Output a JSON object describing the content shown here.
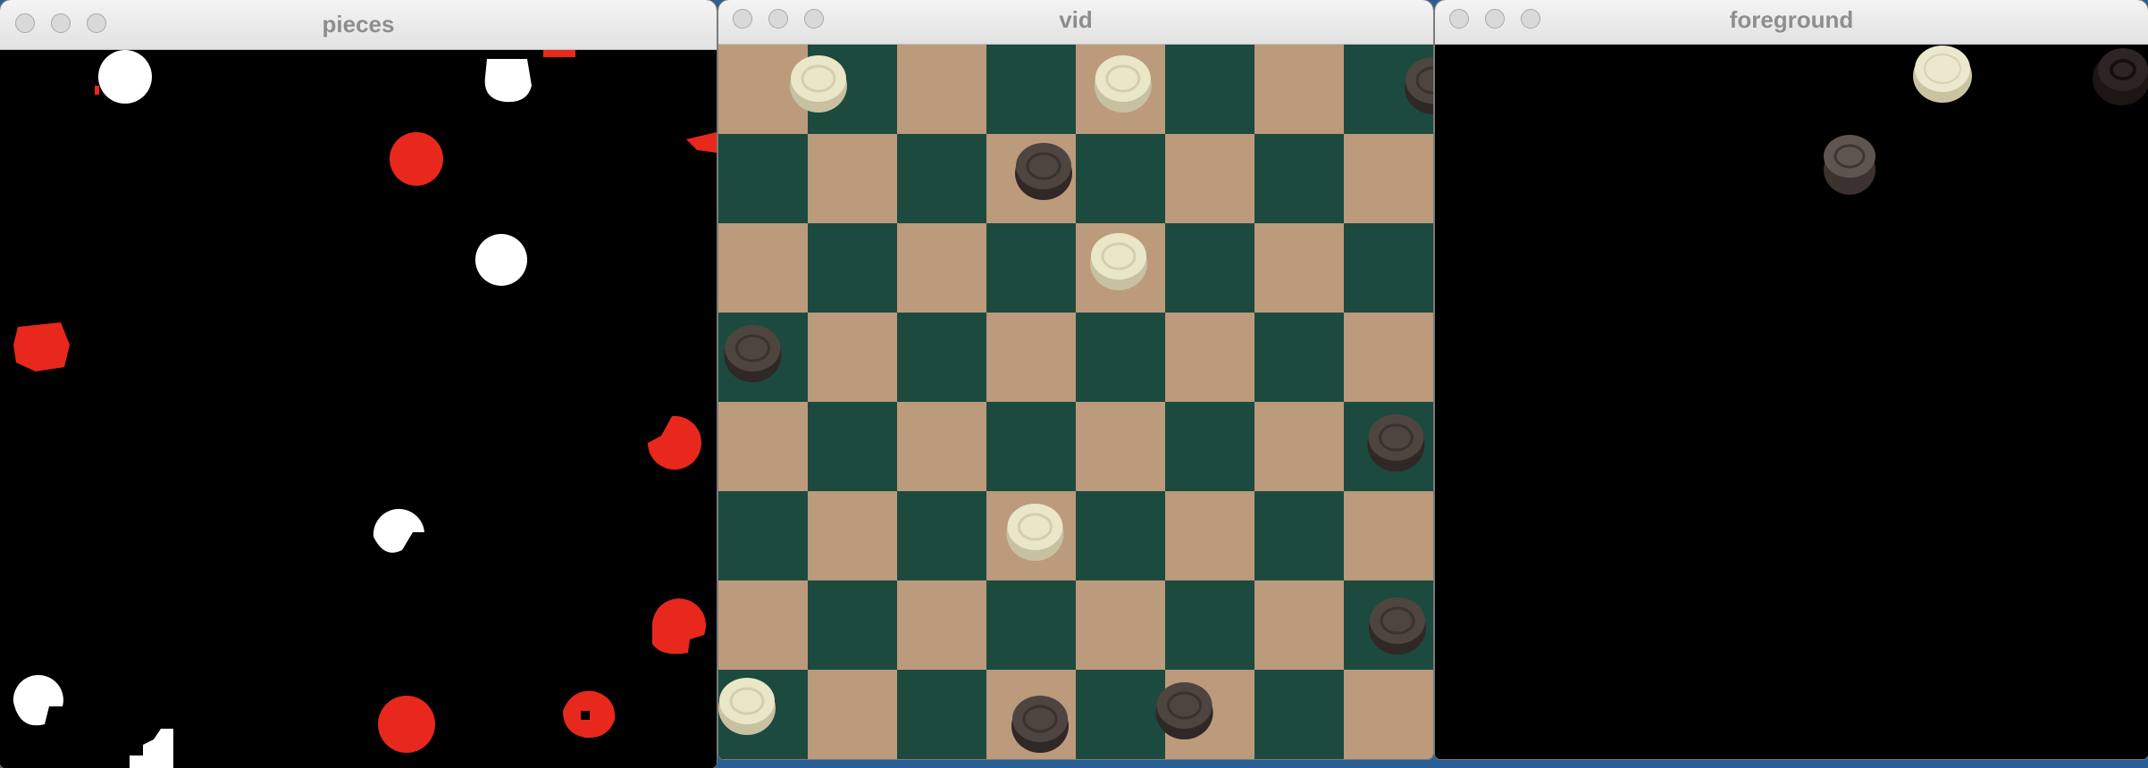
{
  "windows": {
    "pieces": {
      "title": "pieces"
    },
    "vid": {
      "title": "vid"
    },
    "foreground": {
      "title": "foreground"
    }
  },
  "colors": {
    "desktop": "#2a5f95",
    "mask_red": "#e8281c",
    "mask_white": "#ffffff",
    "board_tan": "#bc9a7c",
    "board_green": "#1c4a3f",
    "piece_cream": "#eae6c8",
    "piece_dark": "#4e4541"
  }
}
